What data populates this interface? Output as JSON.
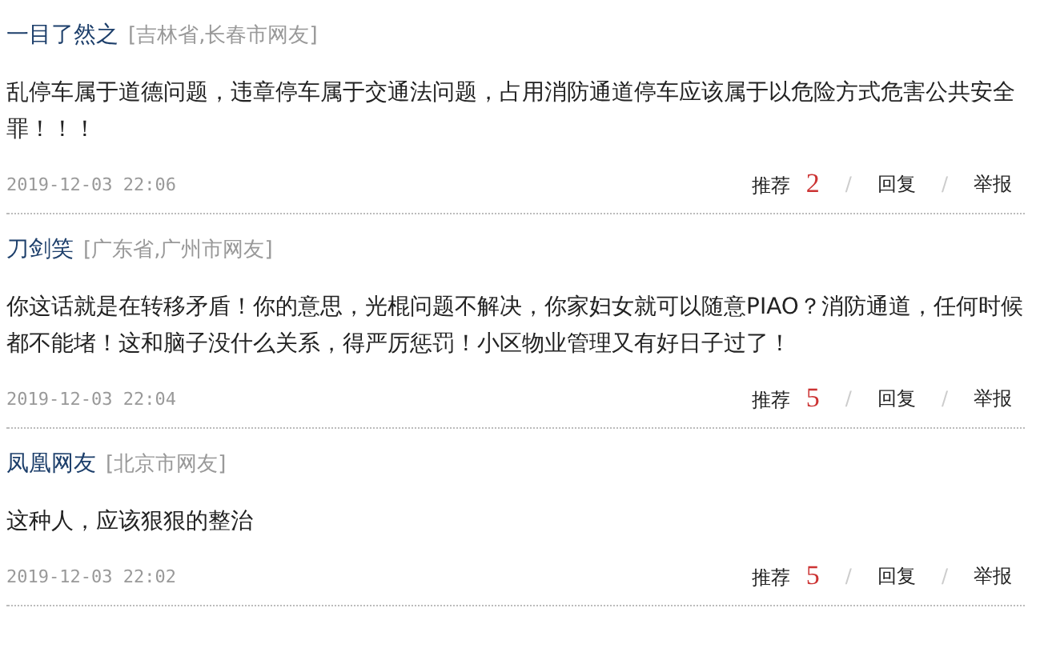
{
  "comments": [
    {
      "user": "一目了然之",
      "location": "[吉林省,长春市网友]",
      "text": "乱停车属于道德问题，违章停车属于交通法问题，占用消防通道停车应该属于以危险方式危害公共安全罪！！！",
      "time": "2019-12-03 22:06",
      "recommend_label": "推荐",
      "recommend_count": "2",
      "separator_1": "/",
      "reply": "回复",
      "separator_2": "/",
      "report": "举报"
    },
    {
      "user": "刀剑笑",
      "location": "[广东省,广州市网友]",
      "text": "你这话就是在转移矛盾！你的意思，光棍问题不解决，你家妇女就可以随意PIAO？消防通道，任何时候都不能堵！这和脑子没什么关系，得严厉惩罚！小区物业管理又有好日子过了！",
      "time": "2019-12-03 22:04",
      "recommend_label": "推荐",
      "recommend_count": "5",
      "separator_1": "/",
      "reply": "回复",
      "separator_2": "/",
      "report": "举报"
    },
    {
      "user": "凤凰网友",
      "location": "[北京市网友]",
      "text": "这种人，应该狠狠的整治",
      "time": "2019-12-03 22:02",
      "recommend_label": "推荐",
      "recommend_count": "5",
      "separator_1": "/",
      "reply": "回复",
      "separator_2": "/",
      "report": "举报"
    }
  ]
}
